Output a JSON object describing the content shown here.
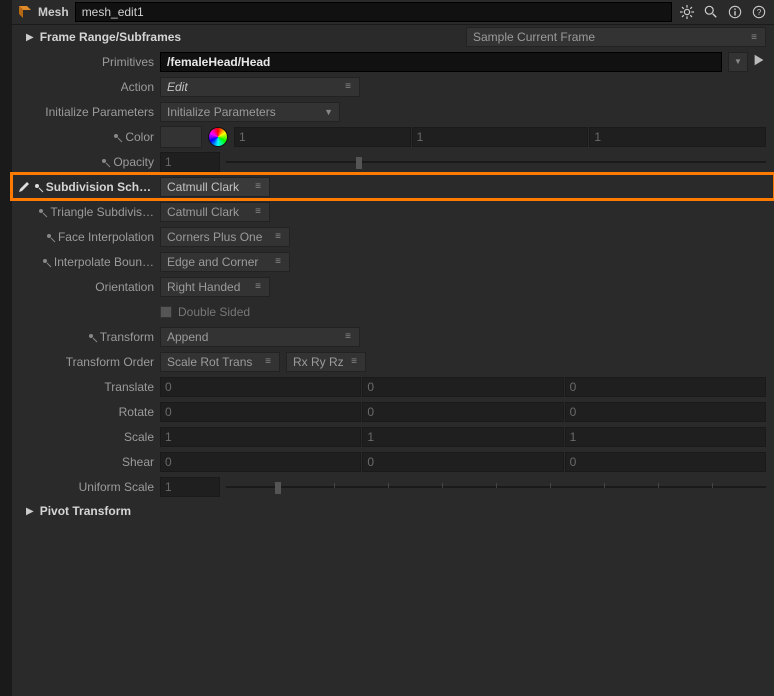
{
  "header": {
    "nodeType": "Mesh",
    "nodeName": "mesh_edit1"
  },
  "sections": {
    "frameRange": "Frame Range/Subframes",
    "pivotTransform": "Pivot Transform"
  },
  "params": {
    "frameRange": {
      "value": "Sample Current Frame"
    },
    "primitives": {
      "label": "Primitives",
      "value": "/femaleHead/Head"
    },
    "action": {
      "label": "Action",
      "value": "Edit"
    },
    "initialize": {
      "label": "Initialize Parameters",
      "value": "Initialize Parameters"
    },
    "color": {
      "label": "Color",
      "r": "1",
      "g": "1",
      "b": "1"
    },
    "opacity": {
      "label": "Opacity",
      "value": "1"
    },
    "subdivScheme": {
      "label": "Subdivision Sche…",
      "value": "Catmull Clark"
    },
    "triangleSubdiv": {
      "label": "Triangle Subdivis…",
      "value": "Catmull Clark"
    },
    "faceInterp": {
      "label": "Face Interpolation",
      "value": "Corners Plus One"
    },
    "interpBoun": {
      "label": "Interpolate Boun…",
      "value": "Edge and Corner"
    },
    "orientation": {
      "label": "Orientation",
      "value": "Right Handed"
    },
    "doubleSided": {
      "label": "Double Sided"
    },
    "transform": {
      "label": "Transform",
      "value": "Append"
    },
    "transformOrder": {
      "label": "Transform Order",
      "value1": "Scale Rot Trans",
      "value2": "Rx Ry Rz"
    },
    "translate": {
      "label": "Translate",
      "x": "0",
      "y": "0",
      "z": "0"
    },
    "rotate": {
      "label": "Rotate",
      "x": "0",
      "y": "0",
      "z": "0"
    },
    "scale": {
      "label": "Scale",
      "x": "1",
      "y": "1",
      "z": "1"
    },
    "shear": {
      "label": "Shear",
      "x": "0",
      "y": "0",
      "z": "0"
    },
    "uniformScale": {
      "label": "Uniform Scale",
      "value": "1"
    }
  }
}
